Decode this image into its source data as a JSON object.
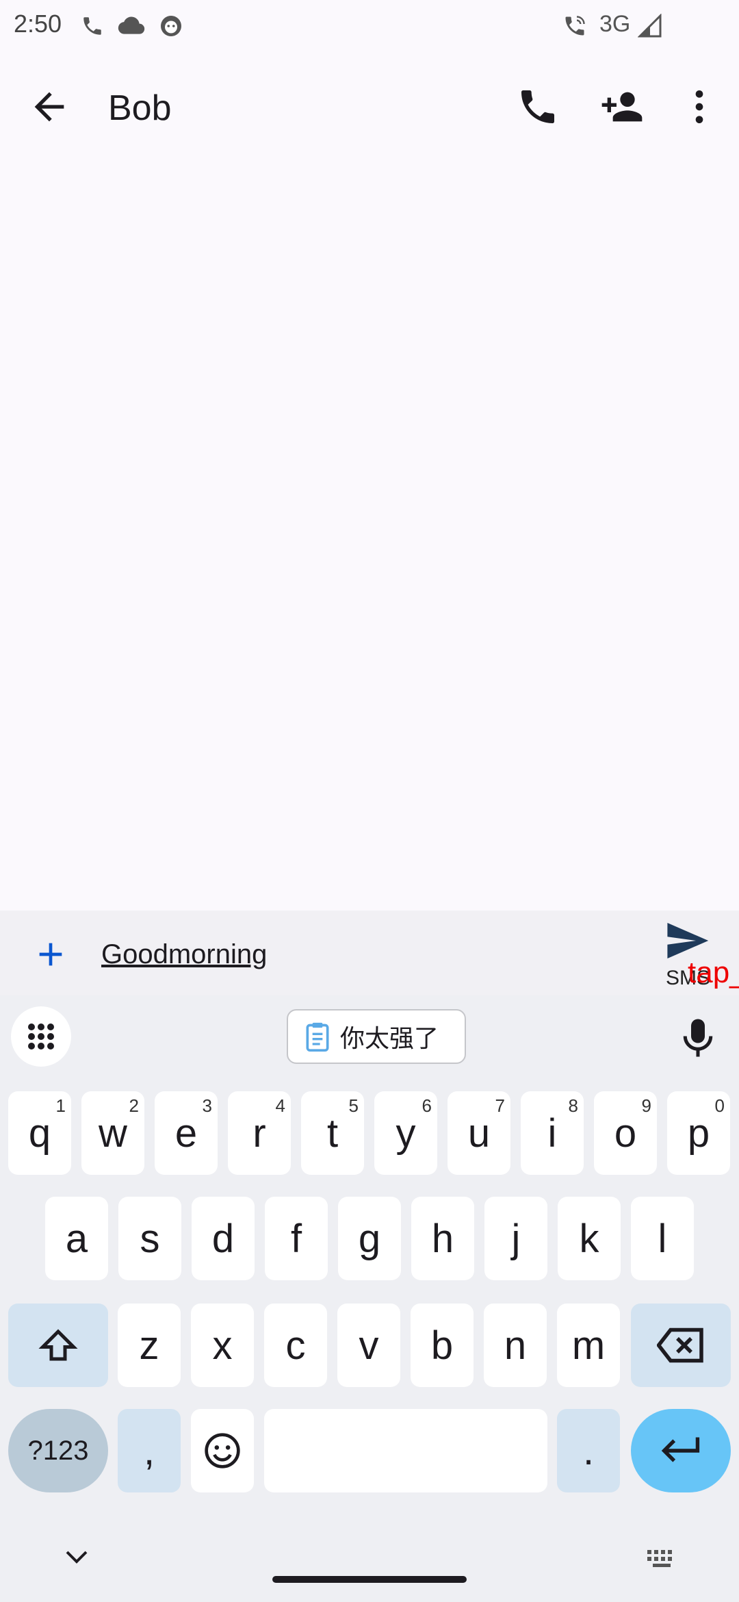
{
  "status_bar": {
    "time": "2:50",
    "network": "3G"
  },
  "header": {
    "contact_name": "Bob"
  },
  "composer": {
    "message_text": "Goodmorning",
    "send_label": "SMS",
    "overlay_label": "tap_"
  },
  "keyboard": {
    "clipboard_suggestion": "你太强了",
    "rows": [
      [
        {
          "k": "q",
          "h": "1"
        },
        {
          "k": "w",
          "h": "2"
        },
        {
          "k": "e",
          "h": "3"
        },
        {
          "k": "r",
          "h": "4"
        },
        {
          "k": "t",
          "h": "5"
        },
        {
          "k": "y",
          "h": "6"
        },
        {
          "k": "u",
          "h": "7"
        },
        {
          "k": "i",
          "h": "8"
        },
        {
          "k": "o",
          "h": "9"
        },
        {
          "k": "p",
          "h": "0"
        }
      ],
      [
        {
          "k": "a"
        },
        {
          "k": "s"
        },
        {
          "k": "d"
        },
        {
          "k": "f"
        },
        {
          "k": "g"
        },
        {
          "k": "h"
        },
        {
          "k": "j"
        },
        {
          "k": "k"
        },
        {
          "k": "l"
        }
      ],
      [
        {
          "k": "z"
        },
        {
          "k": "x"
        },
        {
          "k": "c"
        },
        {
          "k": "v"
        },
        {
          "k": "b"
        },
        {
          "k": "n"
        },
        {
          "k": "m"
        }
      ]
    ],
    "symbols_label": "?123",
    "comma_label": ",",
    "period_label": "."
  },
  "colors": {
    "enter_key": "#67c5f7",
    "mod_key": "#d3e3f1",
    "overlay": "#e00000"
  }
}
